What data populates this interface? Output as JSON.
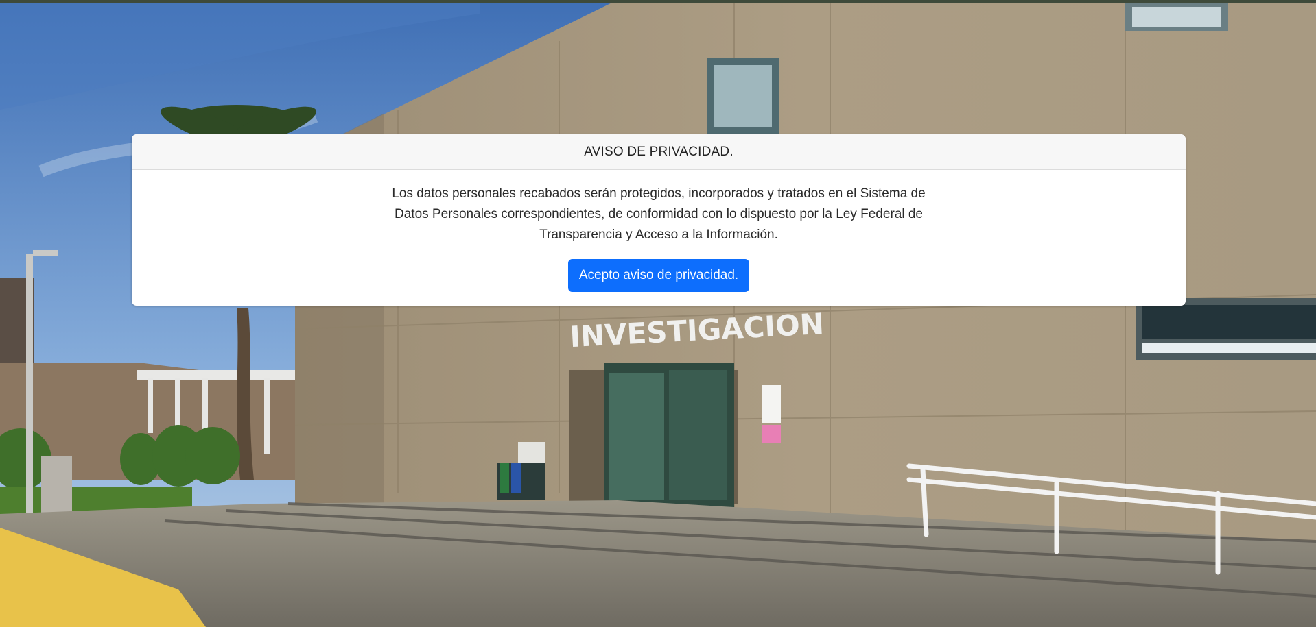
{
  "privacy_notice": {
    "title": "AVISO DE PRIVACIDAD.",
    "text": "Los datos personales recabados serán protegidos, incorporados y tratados en el Sistema de Datos Personales correspondientes, de conformidad con lo dispuesto por la Ley Federal de Transparencia y Acceso a la Información.",
    "accept_label": "Acepto aviso de privacidad."
  },
  "background": {
    "building_sign": "INVESTIGACION"
  },
  "colors": {
    "accent": "#0d6efd",
    "header_bg": "#f7f7f7"
  }
}
